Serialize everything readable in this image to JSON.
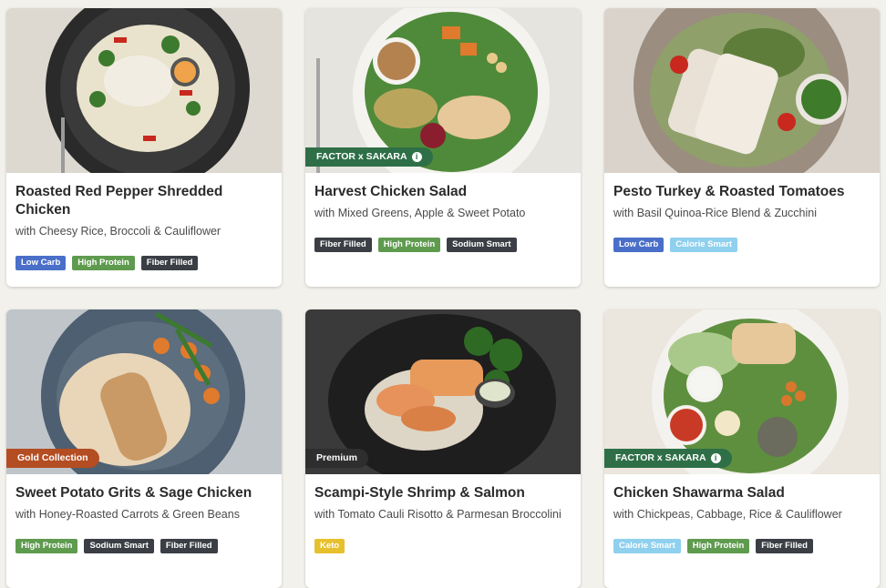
{
  "colors": {
    "low_carb": "#4a6fc9",
    "high_protein": "#5f9b4f",
    "fiber_filled": "#3b3f45",
    "sodium_smart": "#3b3f45",
    "calorie_smart": "#8fd0ee",
    "keto": "#e7c02e",
    "factor_sakara": "#2e6f47",
    "gold_collection": "#b44d22",
    "premium": "#2e2e2e"
  },
  "meals": [
    {
      "title": "Roasted Red Pepper Shredded Chicken",
      "subtitle": "with Cheesy Rice, Broccoli & Cauliflower",
      "badge": "",
      "tags": [
        "Low Carb",
        "High Protein",
        "Fiber Filled"
      ]
    },
    {
      "title": "Harvest Chicken Salad",
      "subtitle": "with Mixed Greens, Apple & Sweet Potato",
      "badge": "FACTOR x SAKARA",
      "badge_icon": "info-icon",
      "tags": [
        "Fiber Filled",
        "High Protein",
        "Sodium Smart"
      ]
    },
    {
      "title": "Pesto Turkey & Roasted Tomatoes",
      "subtitle": "with Basil Quinoa-Rice Blend & Zucchini",
      "badge": "",
      "tags": [
        "Low Carb",
        "Calorie Smart"
      ]
    },
    {
      "title": "Sweet Potato Grits & Sage Chicken",
      "subtitle": "with Honey-Roasted Carrots & Green Beans",
      "badge": "Gold Collection",
      "tags": [
        "High Protein",
        "Sodium Smart",
        "Fiber Filled"
      ]
    },
    {
      "title": "Scampi-Style Shrimp & Salmon",
      "subtitle": "with Tomato Cauli Risotto & Parmesan Broccolini",
      "badge": "Premium",
      "tags": [
        "Keto"
      ]
    },
    {
      "title": "Chicken Shawarma Salad",
      "subtitle": "with Chickpeas, Cabbage, Rice & Cauliflower",
      "badge": "FACTOR x SAKARA",
      "badge_icon": "info-icon",
      "tags": [
        "Calorie Smart",
        "High Protein",
        "Fiber Filled"
      ]
    }
  ]
}
